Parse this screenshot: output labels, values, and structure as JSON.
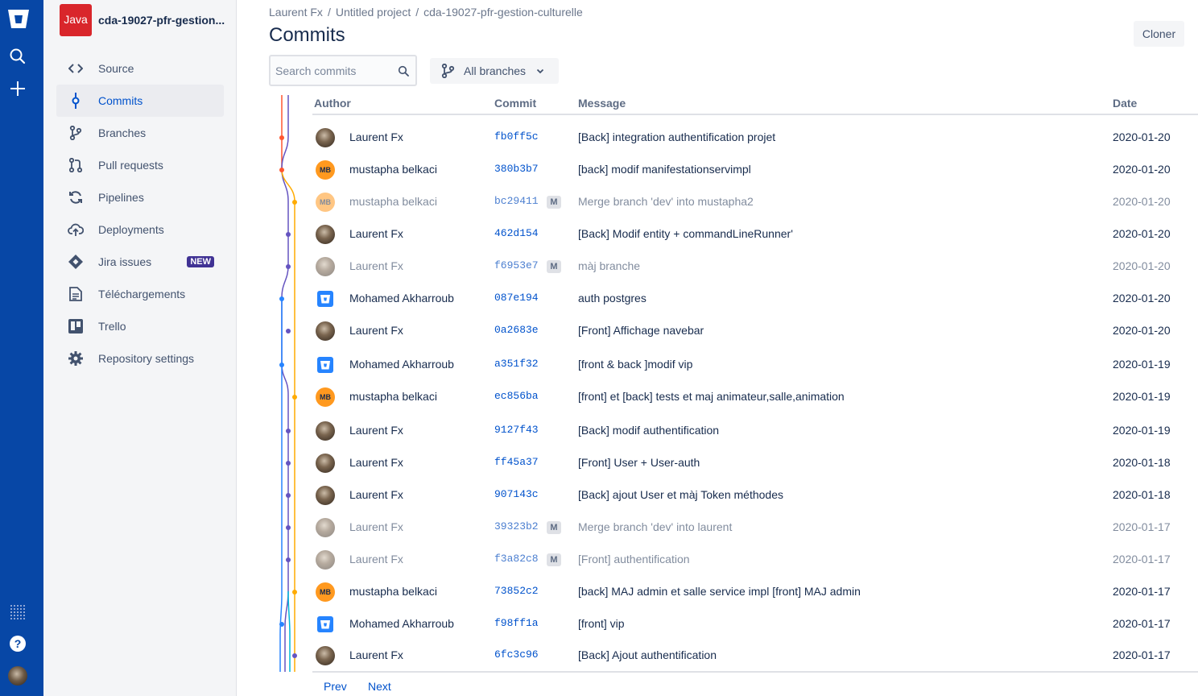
{
  "global_nav": {
    "logo_icon": "bitbucket-logo-icon",
    "icons": [
      "search-icon",
      "create-icon",
      "apps-grid-icon",
      "help-icon"
    ]
  },
  "repo": {
    "language_badge": "Java",
    "name": "cda-19027-pfr-gestion..."
  },
  "sidebar": {
    "items": [
      {
        "label": "Source",
        "icon": "code-icon"
      },
      {
        "label": "Commits",
        "icon": "commit-icon"
      },
      {
        "label": "Branches",
        "icon": "branch-icon"
      },
      {
        "label": "Pull requests",
        "icon": "pull-request-icon"
      },
      {
        "label": "Pipelines",
        "icon": "pipelines-icon"
      },
      {
        "label": "Deployments",
        "icon": "deployments-icon"
      },
      {
        "label": "Jira issues",
        "icon": "jira-icon",
        "badge": "NEW"
      },
      {
        "label": "Téléchargements",
        "icon": "downloads-icon"
      },
      {
        "label": "Trello",
        "icon": "trello-icon"
      },
      {
        "label": "Repository settings",
        "icon": "settings-icon"
      }
    ],
    "active": "Commits"
  },
  "breadcrumbs": [
    "Laurent Fx",
    "Untitled project",
    "cda-19027-pfr-gestion-culturelle"
  ],
  "page_title": "Commits",
  "clone_button": "Cloner",
  "search": {
    "placeholder": "Search commits"
  },
  "branch_filter": {
    "label": "All branches"
  },
  "table": {
    "headers": {
      "author": "Author",
      "commit": "Commit",
      "message": "Message",
      "date": "Date"
    },
    "rows": [
      {
        "author": "Laurent Fx",
        "avatar": "photo",
        "hash": "fb0ff5c",
        "merge": false,
        "message": "[Back] integration authentification projet",
        "date": "2020-01-20"
      },
      {
        "author": "mustapha belkaci",
        "avatar": "MB",
        "hash": "380b3b7",
        "merge": false,
        "message": "[back] modif manifestationservimpl",
        "date": "2020-01-20"
      },
      {
        "author": "mustapha belkaci",
        "avatar": "MB",
        "hash": "bc29411",
        "merge": true,
        "message": "Merge branch 'dev' into mustapha2",
        "date": "2020-01-20"
      },
      {
        "author": "Laurent Fx",
        "avatar": "photo",
        "hash": "462d154",
        "merge": false,
        "message": "[Back] Modif entity + commandLineRunner'",
        "date": "2020-01-20"
      },
      {
        "author": "Laurent Fx",
        "avatar": "photo",
        "hash": "f6953e7",
        "merge": true,
        "message": "màj branche",
        "date": "2020-01-20"
      },
      {
        "author": "Mohamed Akharroub",
        "avatar": "bitbucket",
        "hash": "087e194",
        "merge": false,
        "message": "auth postgres",
        "date": "2020-01-20"
      },
      {
        "author": "Laurent Fx",
        "avatar": "photo",
        "hash": "0a2683e",
        "merge": false,
        "message": "[Front] Affichage navebar",
        "date": "2020-01-20"
      },
      {
        "author": "Mohamed Akharroub",
        "avatar": "bitbucket",
        "hash": "a351f32",
        "merge": false,
        "message": "[front & back ]modif vip",
        "date": "2020-01-19"
      },
      {
        "author": "mustapha belkaci",
        "avatar": "MB",
        "hash": "ec856ba",
        "merge": false,
        "message": "[front] et [back] tests et maj animateur,salle,animation",
        "date": "2020-01-19"
      },
      {
        "author": "Laurent Fx",
        "avatar": "photo",
        "hash": "9127f43",
        "merge": false,
        "message": "[Back] modif authentification",
        "date": "2020-01-19"
      },
      {
        "author": "Laurent Fx",
        "avatar": "photo",
        "hash": "ff45a37",
        "merge": false,
        "message": "[Front] User + User-auth",
        "date": "2020-01-18"
      },
      {
        "author": "Laurent Fx",
        "avatar": "photo",
        "hash": "907143c",
        "merge": false,
        "message": "[Back] ajout User et màj Token méthodes",
        "date": "2020-01-18"
      },
      {
        "author": "Laurent Fx",
        "avatar": "photo",
        "hash": "39323b2",
        "merge": true,
        "message": "Merge branch 'dev' into laurent",
        "date": "2020-01-17"
      },
      {
        "author": "Laurent Fx",
        "avatar": "photo",
        "hash": "f3a82c8",
        "merge": true,
        "message": "[Front] authentification",
        "date": "2020-01-17"
      },
      {
        "author": "mustapha belkaci",
        "avatar": "MB",
        "hash": "73852c2",
        "merge": false,
        "message": "[back] MAJ admin et salle service impl [front] MAJ admin",
        "date": "2020-01-17"
      },
      {
        "author": "Mohamed Akharroub",
        "avatar": "bitbucket",
        "hash": "f98ff1a",
        "merge": false,
        "message": "[front] vip",
        "date": "2020-01-17"
      },
      {
        "author": "Laurent Fx",
        "avatar": "photo",
        "hash": "6fc3c96",
        "merge": false,
        "message": "[Back] Ajout authentification",
        "date": "2020-01-17"
      }
    ],
    "merge_badge": "M"
  },
  "pagination": {
    "prev": "Prev",
    "next": "Next"
  },
  "colors": {
    "nav_blue": "#0747a6",
    "link_blue": "#0052cc",
    "graph_purple": "#6554c0",
    "graph_orange": "#ffab00",
    "graph_red": "#ff5630",
    "graph_blue": "#2684ff",
    "graph_teal": "#00b8d9"
  }
}
